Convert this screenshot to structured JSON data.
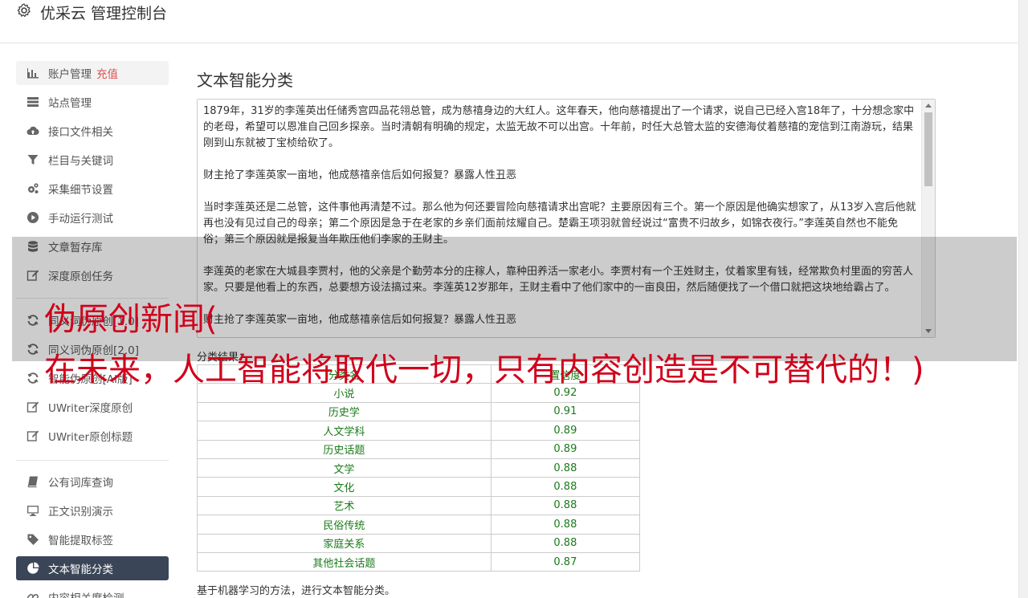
{
  "header": {
    "title": "优采云 管理控制台"
  },
  "sidebar": {
    "items": [
      {
        "label": "账户管理",
        "icon": "bar-chart-icon"
      },
      {
        "label": "站点管理",
        "icon": "server-icon"
      },
      {
        "label": "接口文件相关",
        "icon": "cloud-upload-icon"
      },
      {
        "label": "栏目与关键词",
        "icon": "filter-icon"
      },
      {
        "label": "采集细节设置",
        "icon": "cogs-icon"
      },
      {
        "label": "手动运行测试",
        "icon": "play-circle-icon"
      },
      {
        "label": "文章暂存库",
        "icon": "database-icon"
      },
      {
        "label": "深度原创任务",
        "icon": "edit-icon"
      },
      {
        "label": "同义词伪原创[1.0]",
        "icon": "refresh-icon"
      },
      {
        "label": "同义词伪原创[2.0]",
        "icon": "refresh-icon"
      },
      {
        "label": "智能伪原创[AI版]",
        "icon": "refresh-icon"
      },
      {
        "label": "UWriter深度原创",
        "icon": "edit-icon"
      },
      {
        "label": "UWriter原创标题",
        "icon": "edit-icon"
      },
      {
        "label": "公有词库查询",
        "icon": "book-icon"
      },
      {
        "label": "正文识别演示",
        "icon": "monitor-icon"
      },
      {
        "label": "智能提取标签",
        "icon": "tag-icon"
      },
      {
        "label": "文本智能分类",
        "icon": "pie-chart-icon"
      },
      {
        "label": "内容相关度检测",
        "icon": "link-icon"
      }
    ],
    "recharge": "充值"
  },
  "main": {
    "title": "文本智能分类",
    "paragraphs": [
      "1879年，31岁的李莲英出任储秀宫四品花翎总管，成为慈禧身边的大红人。这年春天，他向慈禧提出了一个请求，说自己已经入宫18年了，十分想念家中的老母，希望可以恩准自己回乡探亲。当时清朝有明确的规定，太监无故不可以出宫。十年前，时任大总管太监的安德海仗着慈禧的宠信到江南游玩，结果刚到山东就被丁宝桢给砍了。",
      "财主抢了李莲英家一亩地，他成慈禧亲信后如何报复？暴露人性丑恶",
      "当时李莲英还是二总管，这件事他再清楚不过。那么他为何还要冒险向慈禧请求出宫呢？主要原因有三个。第一个原因是他确实想家了，从13岁入宫后他就再也没有见过自己的母亲；第二个原因是急于在老家的乡亲们面前炫耀自己。楚霸王项羽就曾经说过“富贵不归故乡，如锦衣夜行。”李莲英自然也不能免俗；第三个原因就是报复当年欺压他们李家的王财主。",
      "李莲英的老家在大城县李贾村，他的父亲是个勤劳本分的庄稼人，靠种田养活一家老小。李贾村有一个王姓财主，仗着家里有钱，经常欺负村里面的穷苦人家。只要是他看上的东西，总要想方设法搞过来。李莲英12岁那年，王财主看中了他们家中的一亩良田，然后随便找了一个借口就把这块地给霸占了。",
      "财主抢了李莲英家一亩地，他成慈禧亲信后如何报复？暴露人性丑恶"
    ],
    "result_label": "分类结果：",
    "table": {
      "headers": [
        "分类名",
        "置信度"
      ],
      "rows": [
        [
          "小说",
          "0.92"
        ],
        [
          "历史学",
          "0.91"
        ],
        [
          "人文学科",
          "0.89"
        ],
        [
          "历史话题",
          "0.89"
        ],
        [
          "文学",
          "0.88"
        ],
        [
          "文化",
          "0.88"
        ],
        [
          "艺术",
          "0.88"
        ],
        [
          "民俗传统",
          "0.88"
        ],
        [
          "家庭关系",
          "0.88"
        ],
        [
          "其他社会话题",
          "0.87"
        ]
      ]
    },
    "footnote": "基于机器学习的方法，进行文本智能分类。"
  },
  "overlay": {
    "line1": "伪原创新闻(",
    "line2": "在未来，人工智能将取代一切，只有内容创造是不可替代的！)"
  },
  "colors": {
    "accent_active": "#3a4657",
    "result_green": "#1a7a1a",
    "overlay_red": "#d0021b",
    "recharge_red": "#d9534f"
  }
}
